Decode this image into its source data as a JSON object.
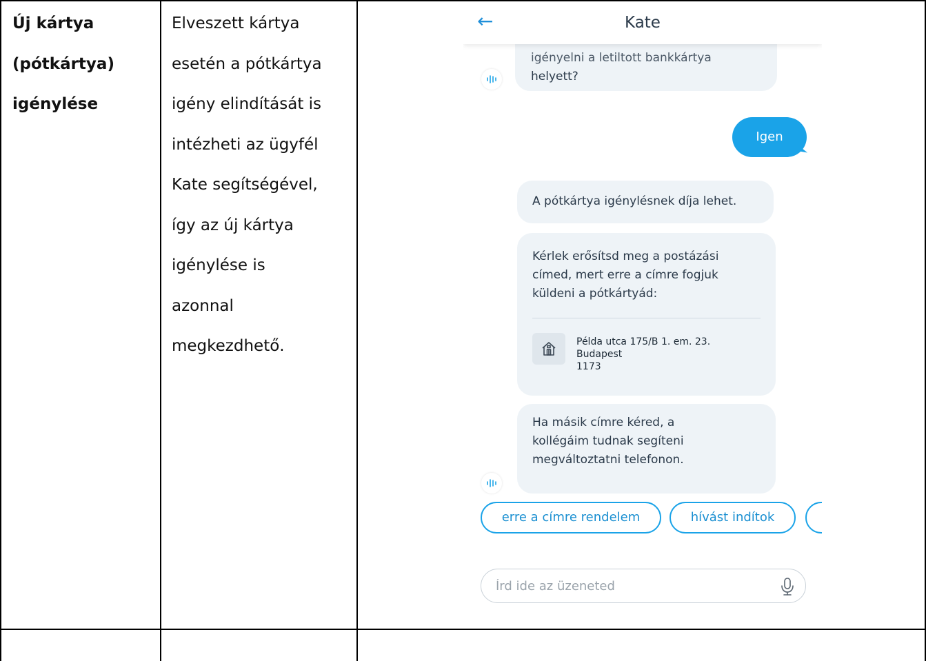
{
  "table": {
    "col1": [
      "Új kártya",
      "(pótkártya)",
      "igénylése"
    ],
    "col2": [
      "Elveszett kártya",
      "esetén a pótkártya",
      "igény elindítását is",
      "intézheti az ügyfél",
      "Kate segítségével,",
      "így az új kártya",
      "igénylése is",
      "azonnal",
      "megkezdhető."
    ]
  },
  "phone": {
    "header": {
      "back_icon": "arrow-left-icon",
      "title": "Kate"
    },
    "messages": {
      "bot1": {
        "cut_line": "igényelni a letiltott bankkártya",
        "line2": "helyett?"
      },
      "user1": "Igen",
      "bot2": "A pótkártya igénylésnek díja lehet.",
      "bot3": {
        "lines": [
          "Kérlek erősítsd meg a postázási",
          "címed, mert erre a címre fogjuk",
          "küldeni a pótkártyád:"
        ],
        "address": {
          "icon": "house-icon",
          "street": "Példa utca 175/B 1. em. 23.",
          "city": "Budapest",
          "zip": "1173"
        }
      },
      "bot4": {
        "lines": [
          "Ha másik címre kéred, a",
          "kollégáim tudnak segíteni",
          "megváltoztatni telefonon."
        ]
      }
    },
    "bot_avatar_icon": "voice-wave-icon",
    "quick_replies": [
      "erre a címre rendelem",
      "hívást indítok"
    ],
    "input": {
      "placeholder": "Írd ide az üzeneted",
      "mic_icon": "microphone-icon"
    },
    "colors": {
      "accent": "#1aa3e8",
      "bubble": "#eef3f7",
      "text": "#2b3a4a"
    }
  }
}
